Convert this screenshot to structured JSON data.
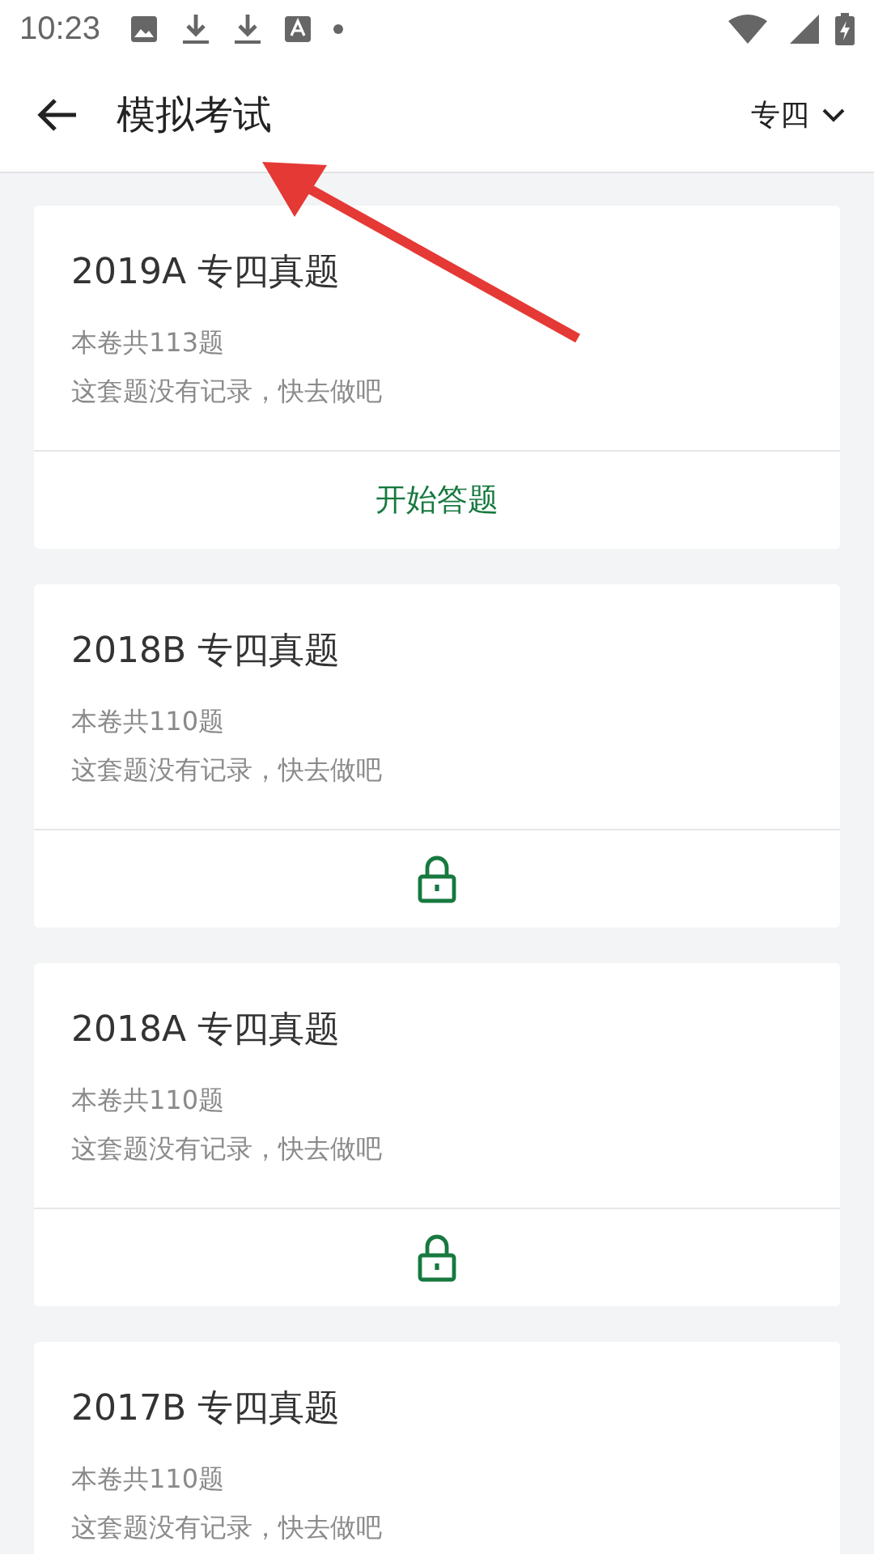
{
  "status_bar": {
    "time": "10:23"
  },
  "header": {
    "title": "模拟考试",
    "filter": "专四"
  },
  "papers": [
    {
      "title": "2019A 专四真题",
      "count": "本卷共113题",
      "record": "这套题没有记录，快去做吧",
      "action": {
        "kind": "start",
        "label": "开始答题"
      }
    },
    {
      "title": "2018B 专四真题",
      "count": "本卷共110题",
      "record": "这套题没有记录，快去做吧",
      "action": {
        "kind": "locked"
      }
    },
    {
      "title": "2018A 专四真题",
      "count": "本卷共110题",
      "record": "这套题没有记录，快去做吧",
      "action": {
        "kind": "locked"
      }
    },
    {
      "title": "2017B 专四真题",
      "count": "本卷共110题",
      "record": "这套题没有记录，快去做吧"
    }
  ]
}
